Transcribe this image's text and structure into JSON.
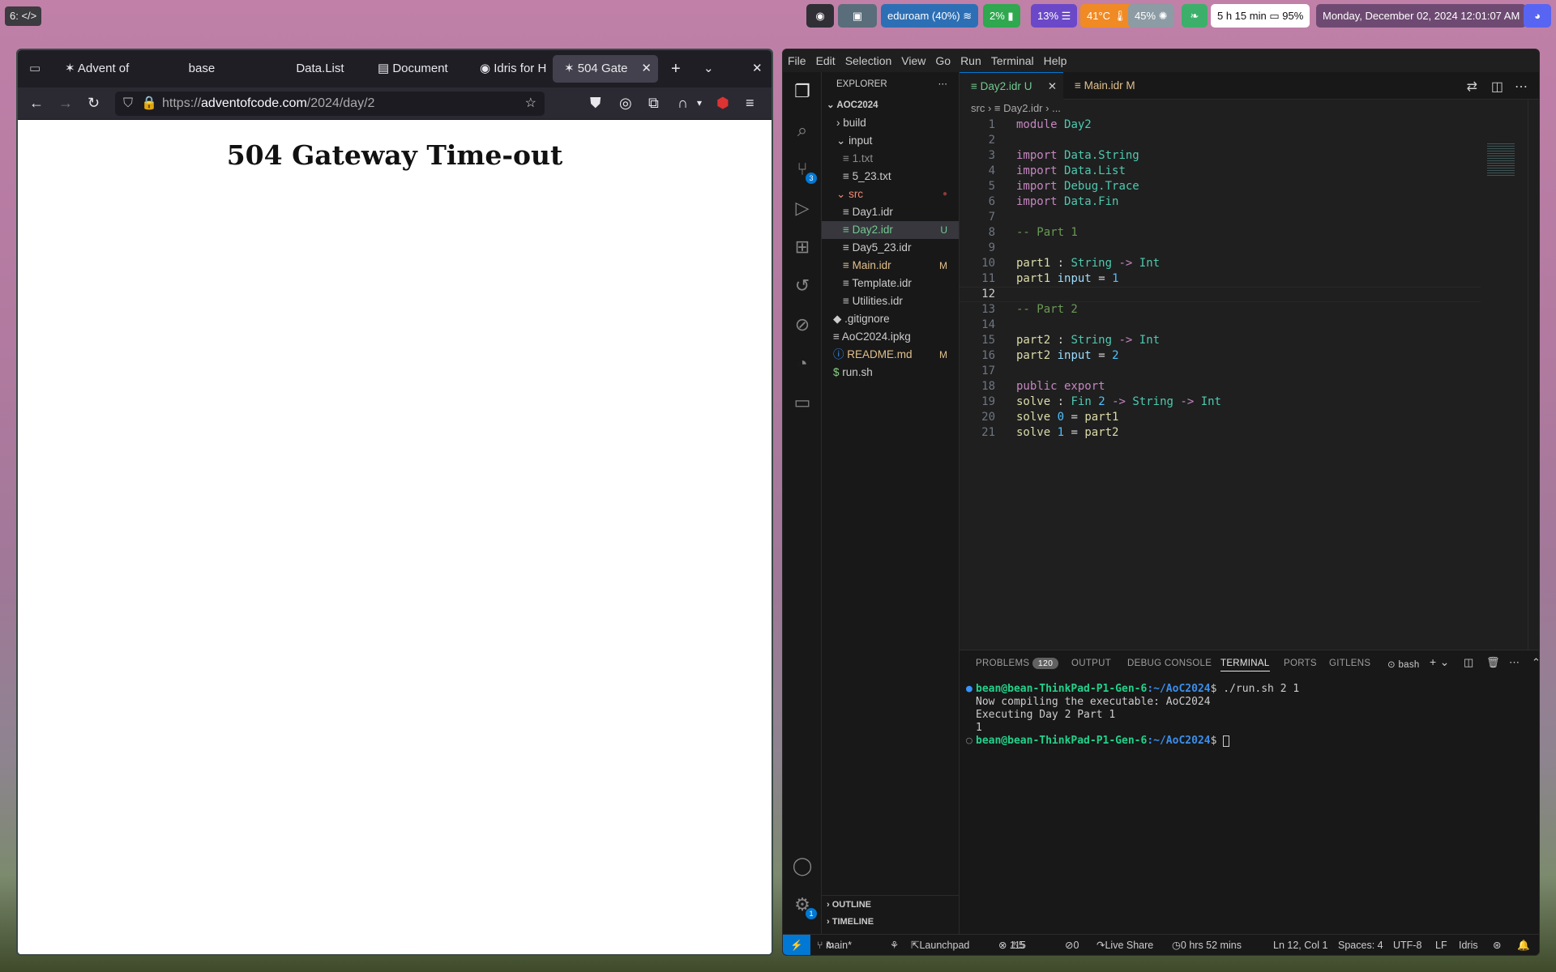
{
  "topbar": {
    "workspace": "6: </>",
    "network": "eduroam (40%)",
    "cpu": "2%",
    "mem": "13%",
    "temp": "41°C",
    "brightness": "45%",
    "battery_time": "5 h 15 min",
    "battery": "95%",
    "datetime": "Monday, December 02, 2024 12:01:07 AM"
  },
  "firefox": {
    "tabs": [
      "Advent of",
      "base",
      "Data.List",
      "Document",
      "Idris for H",
      "504 Gate"
    ],
    "url_prefix": "https://",
    "url_domain": "adventofcode.com",
    "url_path": "/2024/day/2",
    "page_heading": "504 Gateway Time-out"
  },
  "vscode": {
    "menu": [
      "File",
      "Edit",
      "Selection",
      "View",
      "Go",
      "Run",
      "Terminal",
      "Help"
    ],
    "explorer": {
      "title": "EXPLORER",
      "root": "AOC2024",
      "items": [
        {
          "label": "build",
          "status": ""
        },
        {
          "label": "input",
          "status": ""
        },
        {
          "label": "1.txt",
          "status": ""
        },
        {
          "label": "5_23.txt",
          "status": ""
        },
        {
          "label": "src",
          "status": "●"
        },
        {
          "label": "Day1.idr",
          "status": ""
        },
        {
          "label": "Day2.idr",
          "status": "U"
        },
        {
          "label": "Day5_23.idr",
          "status": ""
        },
        {
          "label": "Main.idr",
          "status": "M"
        },
        {
          "label": "Template.idr",
          "status": ""
        },
        {
          "label": "Utilities.idr",
          "status": ""
        },
        {
          "label": ".gitignore",
          "status": ""
        },
        {
          "label": "AoC2024.ipkg",
          "status": ""
        },
        {
          "label": "README.md",
          "status": "M"
        },
        {
          "label": "run.sh",
          "status": ""
        }
      ],
      "outline": "OUTLINE",
      "timeline": "TIMELINE"
    },
    "editor_tabs": [
      {
        "label": "Day2.idr",
        "status": "U"
      },
      {
        "label": "Main.idr",
        "status": "M"
      }
    ],
    "breadcrumb": {
      "dir": "src",
      "file": "Day2.idr",
      "more": "..."
    },
    "scm_badge": "3",
    "settings_badge": "1",
    "panel": {
      "tabs": [
        "PROBLEMS",
        "OUTPUT",
        "DEBUG CONSOLE",
        "TERMINAL",
        "PORTS",
        "GITLENS"
      ],
      "problems_count": "120",
      "shell": "bash",
      "terminal": {
        "prompt": "bean@bean-ThinkPad-P1-Gen-6",
        "cwd": ":~/AoC2024",
        "command": "./run.sh 2 1",
        "output": [
          "Now compiling the executable: AoC2024",
          "Executing Day 2 Part 1",
          "1"
        ]
      }
    },
    "status": {
      "branch": "main*",
      "launchpad": "Launchpad",
      "errors": "115",
      "warnings": "5",
      "ports": "0",
      "liveshare": "Live Share",
      "time": "0 hrs 52 mins",
      "cursor": "Ln 12, Col 1",
      "spaces": "Spaces: 4",
      "encoding": "UTF-8",
      "eol": "LF",
      "language": "Idris"
    }
  },
  "colors": {
    "accent": "#0078d4",
    "modified": "#e2c08d",
    "untracked": "#73c991",
    "prompt": "#23d18b"
  }
}
